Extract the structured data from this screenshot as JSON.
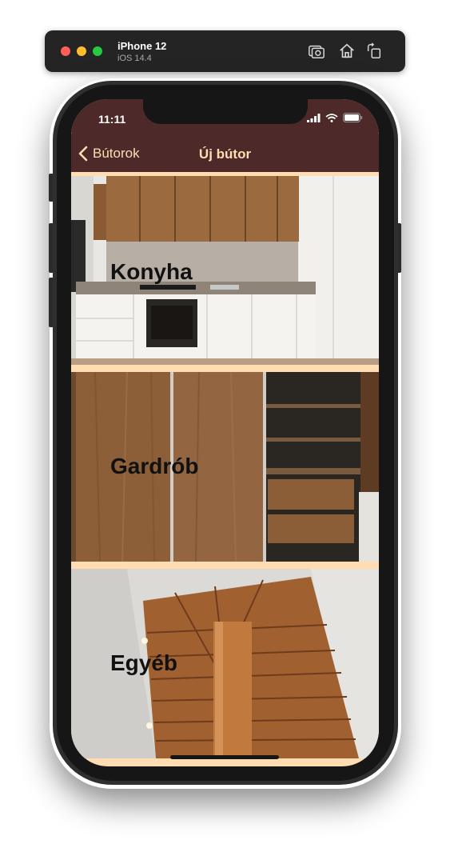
{
  "simulator": {
    "device": "iPhone 12",
    "os": "iOS 14.4",
    "buttons": [
      "screenshot-icon",
      "home-icon",
      "rotate-icon"
    ]
  },
  "status_bar": {
    "time": "11:11",
    "icons": [
      "signal-icon",
      "wifi-icon",
      "battery-icon"
    ]
  },
  "nav": {
    "back_label": "Bútorok",
    "title": "Új bútor"
  },
  "categories": [
    {
      "label": "Konyha"
    },
    {
      "label": "Gardrób"
    },
    {
      "label": "Egyéb"
    }
  ],
  "colors": {
    "header": "#4d2a29",
    "accent": "#ffdcb1",
    "label": "#111111"
  }
}
